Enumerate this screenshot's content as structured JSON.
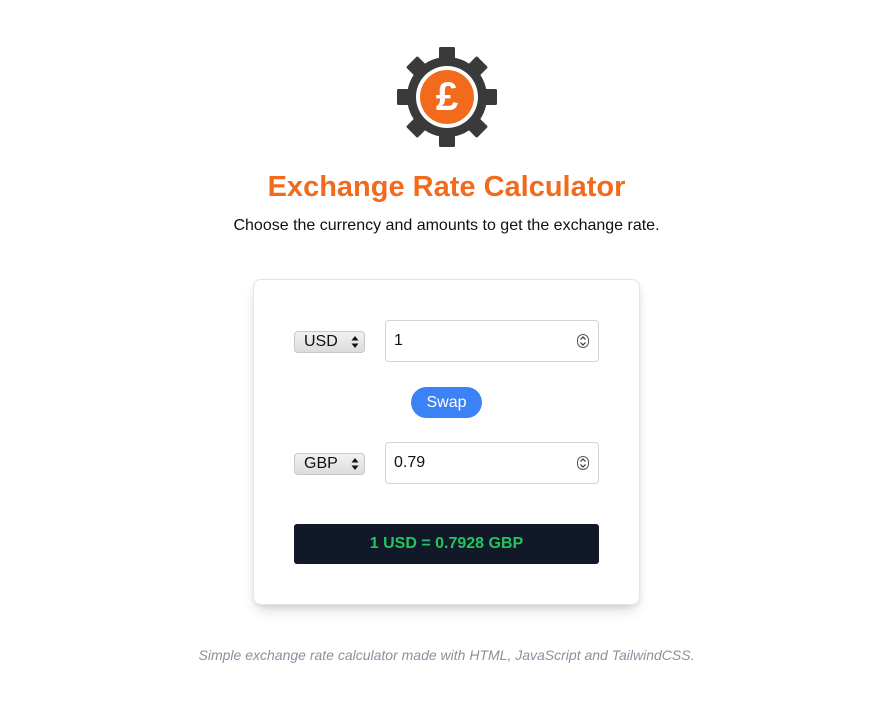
{
  "header": {
    "logo_icon": "gear-pound-icon",
    "title": "Exchange Rate Calculator",
    "subtitle": "Choose the currency and amounts to get the exchange rate."
  },
  "calculator": {
    "from": {
      "currency": "USD",
      "amount": "1"
    },
    "swap_label": "Swap",
    "to": {
      "currency": "GBP",
      "amount": "0.79"
    },
    "rate_text": "1 USD = 0.7928 GBP"
  },
  "footer": {
    "text": "Simple exchange rate calculator made with HTML, JavaScript and TailwindCSS."
  },
  "colors": {
    "title": "#f26b1d",
    "gear": "#3a3a3a",
    "swap_button": "#3b82f6",
    "rate_bar_bg": "#111827",
    "rate_text": "#22c55e",
    "footer_text": "#8a919e"
  }
}
